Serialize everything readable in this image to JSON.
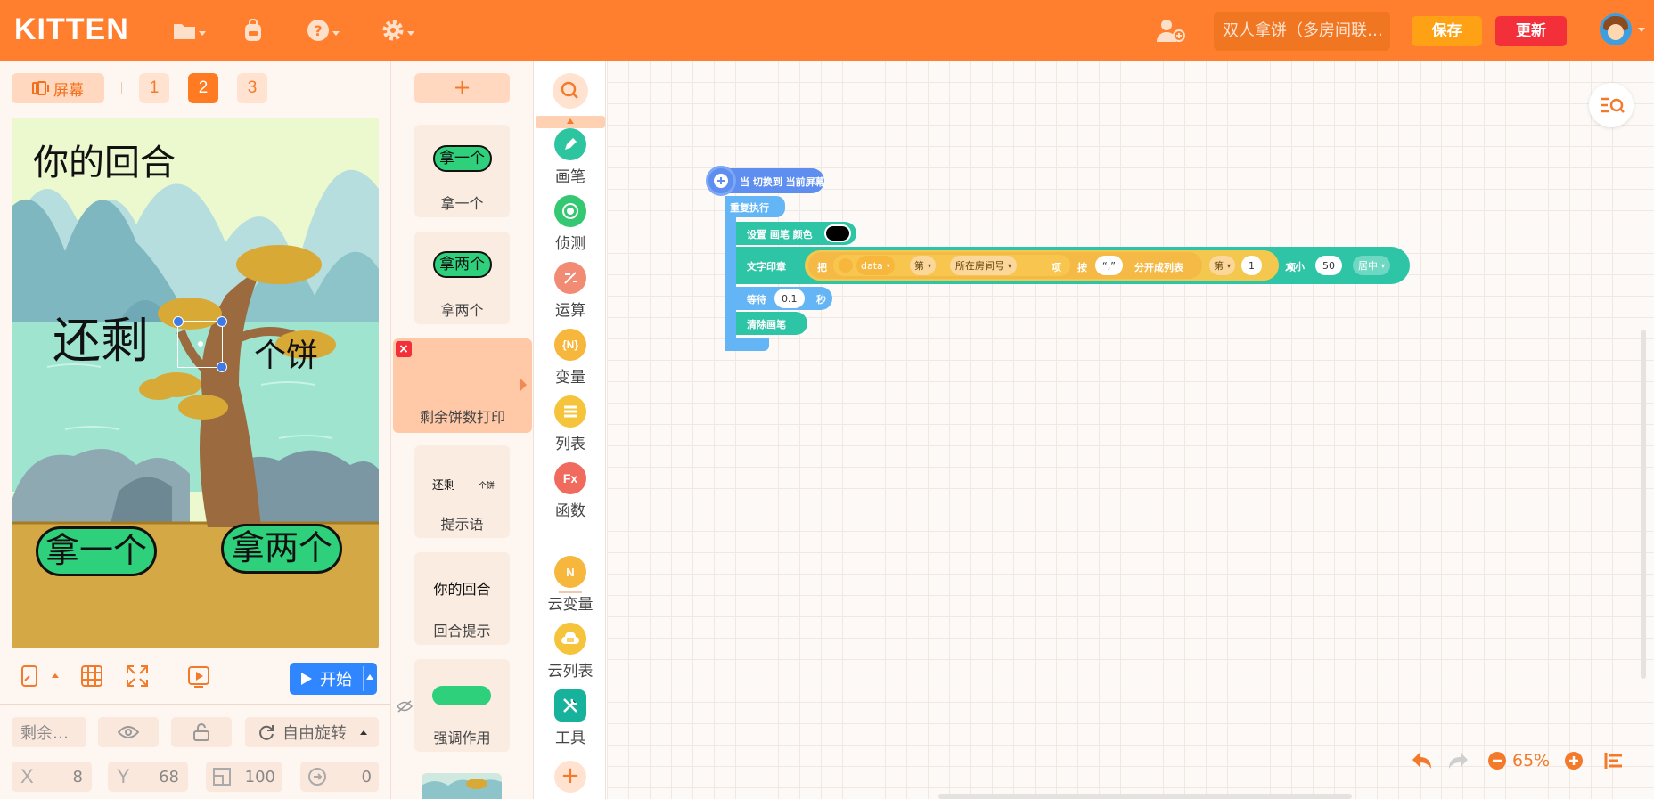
{
  "app": {
    "logo": "KITTEN"
  },
  "topbar": {
    "project_name": "双人拿饼（多房间联…",
    "save_label": "保存",
    "update_label": "更新",
    "icons": [
      "folder-icon",
      "backpack-icon",
      "help-icon",
      "settings-icon",
      "add-collaborator-icon"
    ]
  },
  "screens": {
    "screen_label": "屏幕",
    "pages": [
      "1",
      "2",
      "3"
    ],
    "active_page": "2"
  },
  "stage": {
    "title_text": "你的回合",
    "remaining_text": "还剩",
    "unit_text": "个饼",
    "take_one": "拿一个",
    "take_two": "拿两个"
  },
  "controls": {
    "start_label": "开始"
  },
  "properties": {
    "name": "剩余…",
    "rotation_label": "自由旋转",
    "x_label": "X",
    "x": "8",
    "y_label": "Y",
    "y": "68",
    "size": "100",
    "direction": "0"
  },
  "assets": {
    "add_label": "+",
    "items": [
      {
        "thumb": "拿一个",
        "label": "拿一个"
      },
      {
        "thumb": "拿两个",
        "label": "拿两个"
      },
      {
        "thumb": "",
        "label": "剩余饼数打印"
      },
      {
        "thumb_a": "还剩",
        "thumb_b": "个饼",
        "label": "提示语"
      },
      {
        "thumb": "你的回合",
        "label": "回合提示"
      },
      {
        "thumb": "",
        "label": "强调作用"
      }
    ]
  },
  "categories": [
    {
      "label": "画笔",
      "color": "#2dc5a0",
      "icon": "pen-icon"
    },
    {
      "label": "侦测",
      "color": "#34c872",
      "icon": "sensing-icon"
    },
    {
      "label": "运算",
      "color": "#f18b73",
      "icon": "operator-icon"
    },
    {
      "label": "变量",
      "color": "#f6b73c",
      "icon": "variable-icon",
      "glyph": "{N}"
    },
    {
      "label": "列表",
      "color": "#f5c43a",
      "icon": "list-icon"
    },
    {
      "label": "函数",
      "color": "#f06b5e",
      "icon": "function-icon",
      "glyph": "Fx"
    },
    {
      "label": "云变量",
      "color": "#f6b73c",
      "icon": "cloud-variable-icon",
      "glyph": "N"
    },
    {
      "label": "云列表",
      "color": "#f5c43a",
      "icon": "cloud-list-icon"
    },
    {
      "label": "工具",
      "color": "#17b29b",
      "icon": "tools-icon"
    }
  ],
  "blocks": {
    "hat": "当 切换到 当前屏幕",
    "repeat": "重复执行",
    "set_pen": "设置 画笔 颜色",
    "print_text": "文字印章",
    "print_ba": "把",
    "data_var": "data",
    "di": "第",
    "room_num": "所在房间号",
    "xiang": "项",
    "an": "按",
    "delim": "“,”",
    "split_list": "分开成列表",
    "di2": "第",
    "one": "1",
    "xiang2": "项",
    "size_label": "大小",
    "size_value": "50",
    "align": "居中",
    "wait_label": "等待",
    "wait_value": "0.1",
    "sec": "秒",
    "clear_pen": "清除画笔"
  },
  "workspace": {
    "zoom": "65%"
  },
  "colors": {
    "brand_orange": "#ff7f2e",
    "save": "#ffa114",
    "update": "#f3303a",
    "start": "#2f86ff",
    "event_block": "#5d8ef0",
    "control_block": "#64b5f6",
    "pen_block": "#2ec4a6",
    "operator_block": "#f5b946",
    "list_block": "#f4c84f"
  }
}
